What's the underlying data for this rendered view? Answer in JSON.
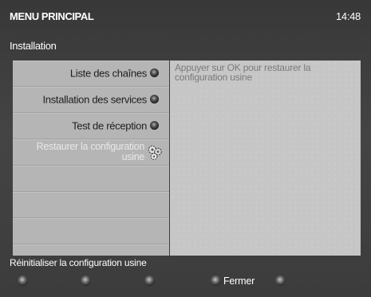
{
  "header": {
    "title": "MENU PRINCIPAL",
    "time": "14:48"
  },
  "section": {
    "title": "Installation"
  },
  "menu": {
    "items": [
      {
        "label": "Liste des chaînes",
        "icon": "round-bullet-icon"
      },
      {
        "label": "Installation des services",
        "icon": "round-bullet-icon"
      },
      {
        "label": "Test de réception",
        "icon": "round-bullet-icon"
      },
      {
        "lines": [
          "Restaurer la configuration",
          "usine"
        ],
        "icon": "gears-icon",
        "selected": true
      }
    ]
  },
  "info": {
    "lines": [
      "Appuyer sur OK pour restaurer la",
      "configuration usine"
    ]
  },
  "footer": {
    "hint": "Réinitialiser la configuration usine",
    "keys": [
      {
        "icon": "remote-key-icon"
      },
      {
        "icon": "remote-key-icon"
      },
      {
        "icon": "remote-key-icon"
      },
      {
        "icon": "remote-key-icon",
        "label": "Fermer"
      },
      {
        "icon": "remote-key-icon"
      }
    ]
  },
  "colors": {
    "menu_background": "#b5b5b5",
    "info_background": "#c6c6c6",
    "info_text": "#7a7a7a",
    "selected_text": "#e8e8e8"
  }
}
